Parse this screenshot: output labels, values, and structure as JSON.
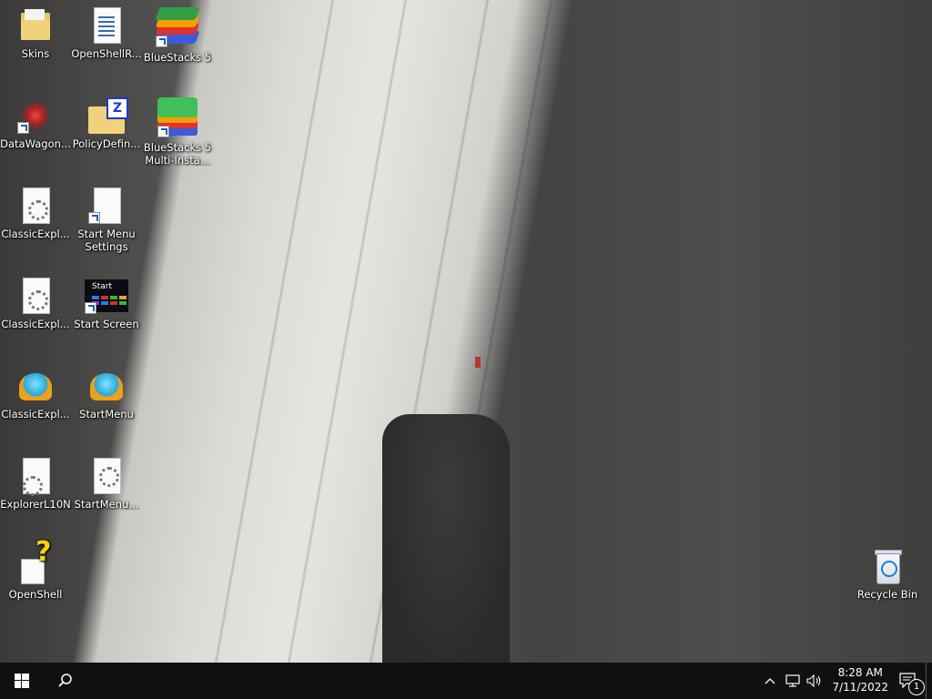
{
  "desktop": {
    "icons": [
      {
        "label": "Skins",
        "icon": "folder-icon"
      },
      {
        "label": "OpenShellR...",
        "icon": "document-icon"
      },
      {
        "label": "BlueStacks 5",
        "icon": "bluestacks-icon"
      },
      {
        "label": "DataWagon...",
        "icon": "datawagon-icon"
      },
      {
        "label": "PolicyDefin...",
        "icon": "zip-folder-icon"
      },
      {
        "label": "BlueStacks 5 Multi-Insta...",
        "icon": "bluestacks-multi-icon"
      },
      {
        "label": "ClassicExpl...",
        "icon": "settings-file-icon"
      },
      {
        "label": "Start Menu Settings",
        "icon": "blank-file-icon"
      },
      {
        "label": "ClassicExpl...",
        "icon": "settings-file-icon"
      },
      {
        "label": "Start Screen",
        "icon": "start-screen-icon"
      },
      {
        "label": "ClassicExpl...",
        "icon": "shell-icon"
      },
      {
        "label": "StartMenu",
        "icon": "shell-icon"
      },
      {
        "label": "ExplorerL10N",
        "icon": "settings-file-icon"
      },
      {
        "label": "StartMenu...",
        "icon": "settings-file-icon"
      },
      {
        "label": "OpenShell",
        "icon": "help-file-icon"
      },
      {
        "label": "Recycle Bin",
        "icon": "recycle-bin-icon"
      }
    ],
    "start_screen_text": "Start"
  },
  "taskbar": {
    "time": "8:28 AM",
    "date": "7/11/2022",
    "notification_count": "1"
  }
}
